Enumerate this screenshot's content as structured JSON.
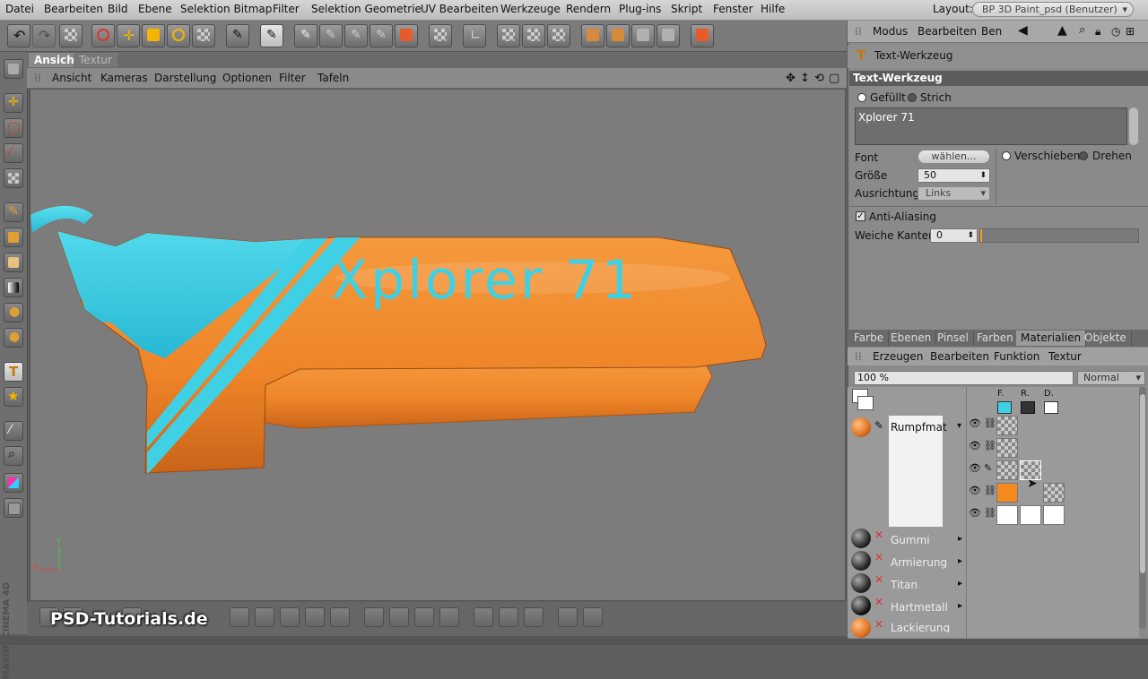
{
  "menubar": {
    "items": [
      "Datei",
      "Bearbeiten",
      "Bild",
      "Ebene",
      "Selektion Bitmap",
      "Filter",
      "Selektion Geometrie",
      "UV Bearbeiten",
      "Werkzeuge",
      "Rendern",
      "Plug-ins",
      "Skript",
      "Fenster",
      "Hilfe"
    ],
    "layout_label": "Layout:",
    "layout_value": "BP 3D Paint_psd (Benutzer)"
  },
  "viewport": {
    "tabs": [
      "Ansicht",
      "Textur"
    ],
    "menu": [
      "Ansicht",
      "Kameras",
      "Darstellung",
      "Optionen",
      "Filter",
      "Tafeln"
    ],
    "scene_text": "Xplorer 71",
    "axis_y": "Y",
    "axis_x": "X"
  },
  "side_brand": "MAXON CINEMA 4D",
  "watermark": "PSD-Tutorials.de",
  "attributes": {
    "menu": [
      "Modus",
      "Bearbeiten",
      "Ben"
    ],
    "tool_title": "Text-Werkzeug",
    "section_title": "Text-Werkzeug",
    "fill_label": "Gefüllt",
    "stroke_label": "Strich",
    "text_value": "Xplorer 71",
    "font_label": "Font",
    "font_button": "wählen...",
    "size_label": "Größe",
    "size_value": "50",
    "align_label": "Ausrichtung",
    "align_value": "Links",
    "move_label": "Verschieben",
    "rotate_label": "Drehen",
    "antialias_label": "Anti-Aliasing",
    "soft_edges_label": "Weiche Kanten",
    "soft_edges_value": "0"
  },
  "materials": {
    "tabs": [
      "Farbe",
      "Ebenen",
      "Pinsel",
      "Farben",
      "Materialien",
      "Objekte"
    ],
    "active_tab": "Materialien",
    "menu": [
      "Erzeugen",
      "Bearbeiten",
      "Funktion",
      "Textur"
    ],
    "opacity": "100 %",
    "blend_mode": "Normal",
    "channel_headers": [
      "F.",
      "R.",
      "D."
    ],
    "list": [
      {
        "name": "Rumpfmat"
      },
      {
        "name": "Gummi"
      },
      {
        "name": "Armierung"
      },
      {
        "name": "Titan"
      },
      {
        "name": "Hartmetall"
      },
      {
        "name": "Lackierung"
      }
    ]
  },
  "colors": {
    "hull_orange": "#f08a2c",
    "accent_cyan": "#3fd0e6",
    "panel_header": "#5c5c5c"
  }
}
